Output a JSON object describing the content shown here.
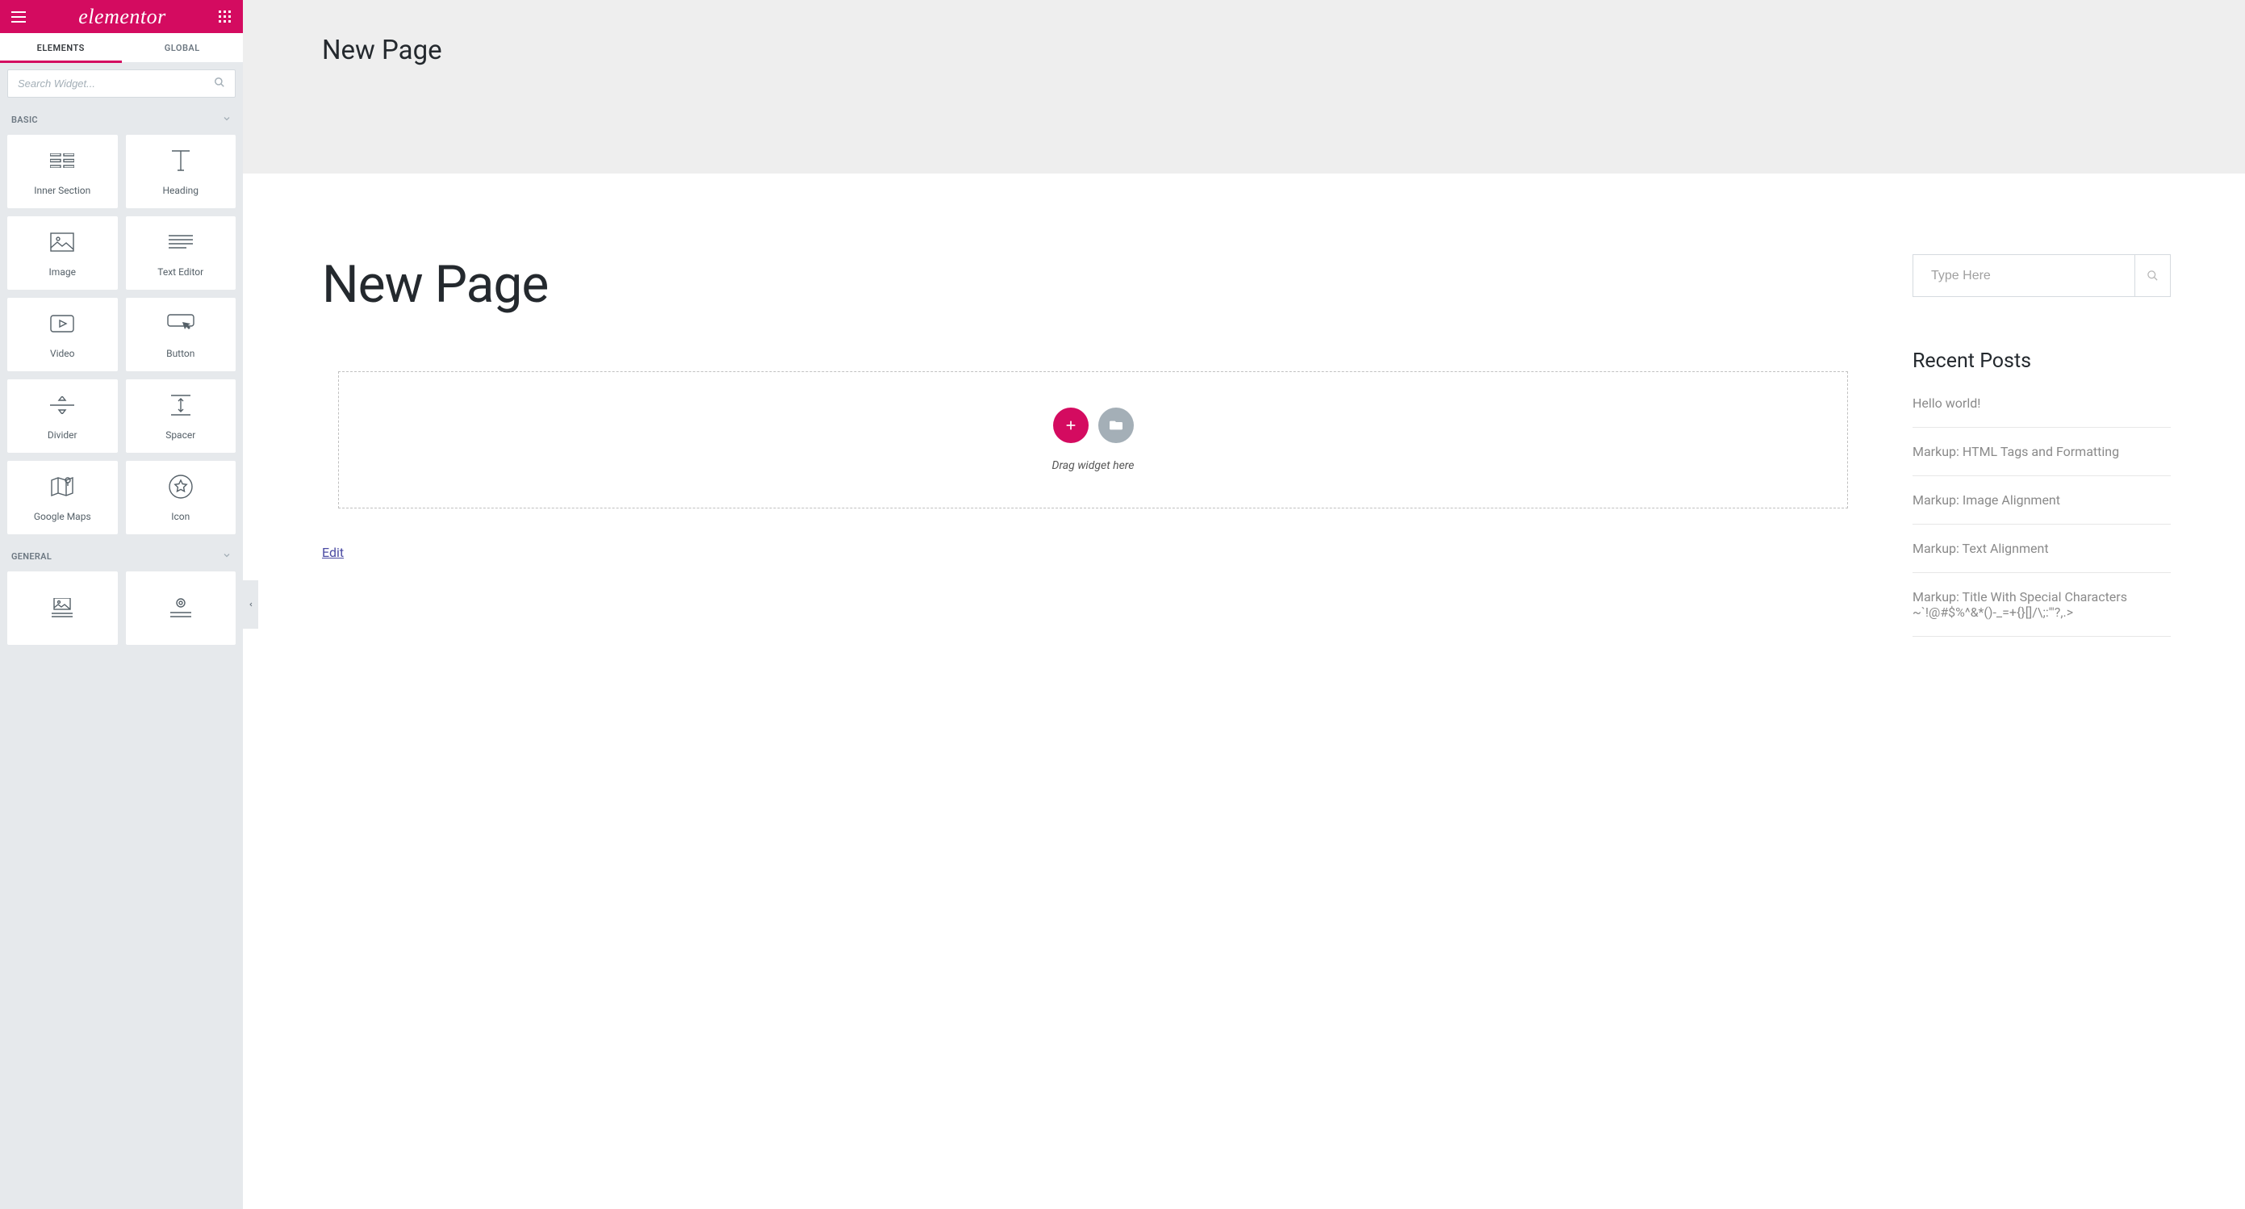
{
  "brand": "elementor",
  "tabs": {
    "elements": "ELEMENTS",
    "global": "GLOBAL"
  },
  "search": {
    "placeholder": "Search Widget..."
  },
  "categories": {
    "basic": "BASIC",
    "general": "GENERAL"
  },
  "widgets": {
    "basic": [
      {
        "id": "inner-section",
        "label": "Inner Section"
      },
      {
        "id": "heading",
        "label": "Heading"
      },
      {
        "id": "image",
        "label": "Image"
      },
      {
        "id": "text-editor",
        "label": "Text Editor"
      },
      {
        "id": "video",
        "label": "Video"
      },
      {
        "id": "button",
        "label": "Button"
      },
      {
        "id": "divider",
        "label": "Divider"
      },
      {
        "id": "spacer",
        "label": "Spacer"
      },
      {
        "id": "google-maps",
        "label": "Google Maps"
      },
      {
        "id": "icon",
        "label": "Icon"
      }
    ]
  },
  "banner": {
    "title": "New Page"
  },
  "page": {
    "title": "New Page",
    "drop_hint": "Drag widget here",
    "edit": "Edit"
  },
  "side": {
    "search_placeholder": "Type Here",
    "recent_heading": "Recent Posts",
    "posts": [
      "Hello world!",
      "Markup: HTML Tags and Formatting",
      "Markup: Image Alignment",
      "Markup: Text Alignment",
      "Markup: Title With Special Characters ~`!@#$%^&*()-_=+{}[]/\\;:'\"?,.>"
    ]
  }
}
